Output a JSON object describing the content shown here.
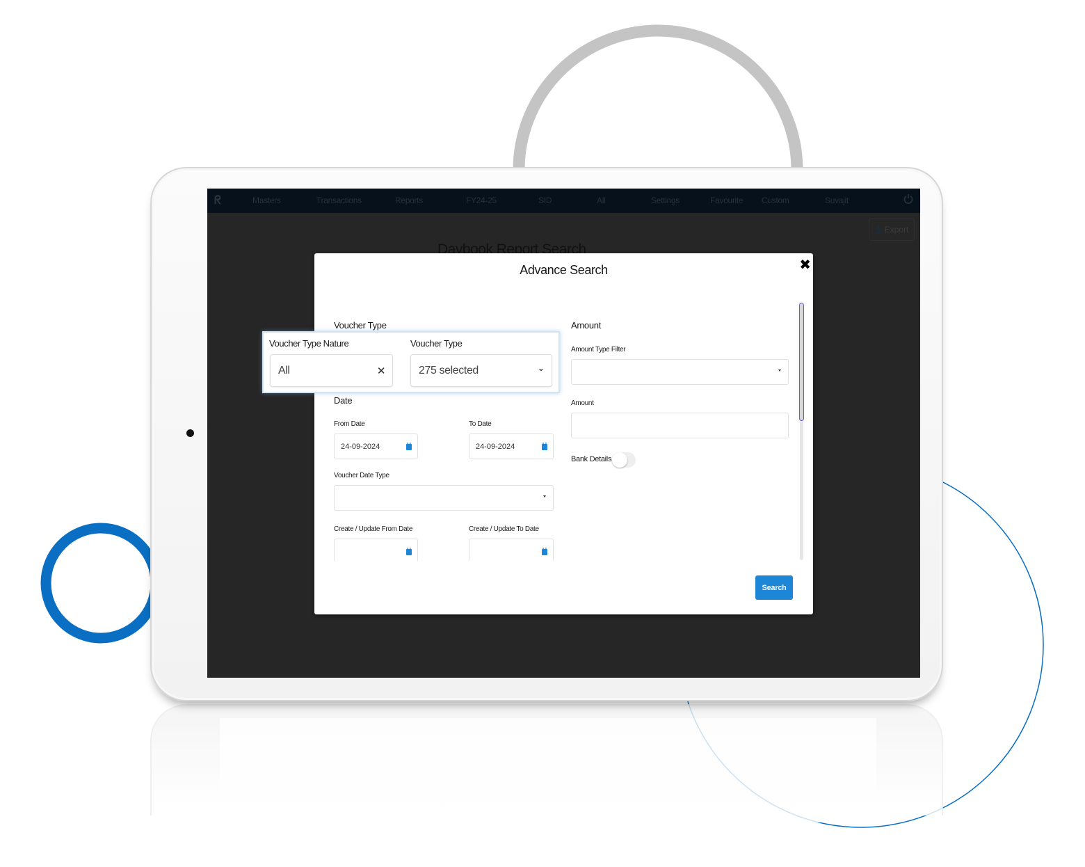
{
  "navbar": {
    "logo": "logo-icon",
    "items": [
      {
        "label": "Masters"
      },
      {
        "label": "Transactions"
      },
      {
        "label": "Reports"
      },
      {
        "label": "FY24-25"
      },
      {
        "label": "SID"
      },
      {
        "label": "All"
      },
      {
        "label": "Settings"
      },
      {
        "label": "Favourite"
      },
      {
        "label": "Custom"
      },
      {
        "label": "Suvajit"
      }
    ],
    "power_icon": "power-icon"
  },
  "toolbar": {
    "export_label": "Export",
    "export_icon": "download-icon"
  },
  "page": {
    "title": "Daybook Report Search"
  },
  "modal": {
    "title": "Advance Search",
    "close_icon": "close-icon",
    "voucher_section": {
      "heading": "Voucher Type",
      "nature_label": "Voucher Type Nature",
      "nature_value": "All",
      "type_label": "Voucher Type",
      "type_value": "275 selected"
    },
    "date_section": {
      "heading": "Date",
      "from_label": "From Date",
      "from_value": "24-09-2024",
      "to_label": "To Date",
      "to_value": "24-09-2024",
      "voucher_date_type_label": "Voucher Date Type",
      "voucher_date_type_value": "",
      "cu_from_label": "Create / Update From Date",
      "cu_from_value": "",
      "cu_to_label": "Create / Update To Date",
      "cu_to_value": ""
    },
    "amount_section": {
      "heading": "Amount",
      "type_filter_label": "Amount Type Filter",
      "type_filter_value": "",
      "amount_label": "Amount",
      "amount_value": "",
      "bank_details_label": "Bank Details",
      "bank_details_on": false
    },
    "search_label": "Search"
  },
  "colors": {
    "accent": "#1e86d6",
    "navbar_bg": "#07111c",
    "screen_bg": "#262626",
    "deco_blue": "#0a6fc2",
    "deco_gray": "#c4c4c4"
  }
}
